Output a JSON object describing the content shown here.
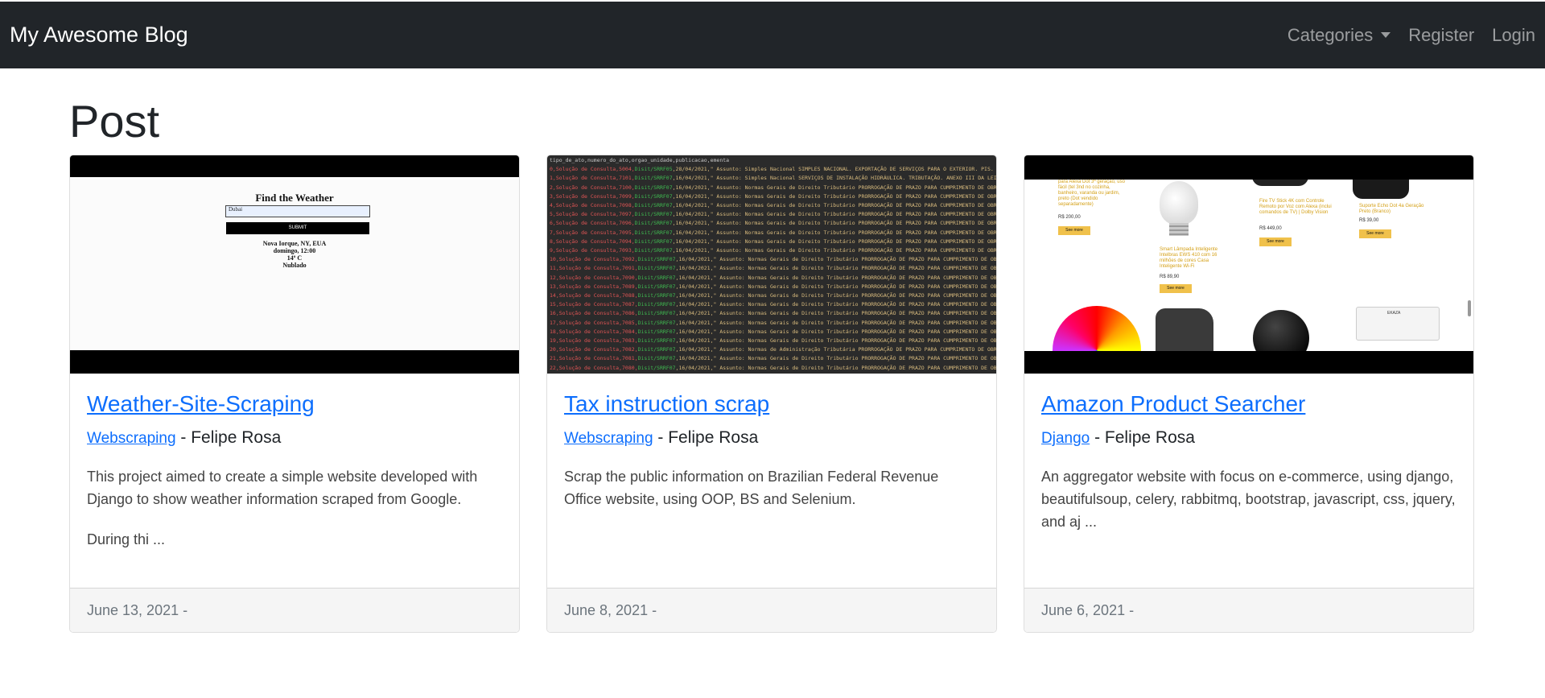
{
  "navbar": {
    "brand": "My Awesome Blog",
    "links": [
      {
        "label": "Categories",
        "dropdown": true
      },
      {
        "label": "Register",
        "dropdown": false
      },
      {
        "label": "Login",
        "dropdown": false
      }
    ]
  },
  "page": {
    "title": "Post"
  },
  "posts": [
    {
      "title": "Weather-Site-Scraping",
      "category": "Webscraping",
      "author": "- Felipe Rosa",
      "excerpt_1": "This project aimed to create a simple website developed with Django to show weather information scraped from Google.",
      "excerpt_2": "During thi ...",
      "date": "June 13, 2021 -",
      "thumb": {
        "title": "Find the Weather",
        "input_value": "Dubai",
        "button": "SUBMIT",
        "lines": [
          "Nova Iorque, NY, EUA",
          "domingo, 12:00",
          "14º C",
          "Nublado"
        ]
      }
    },
    {
      "title": "Tax instruction scrap",
      "category": "Webscraping",
      "author": "- Felipe Rosa",
      "excerpt_1": "Scrap the public information on Brazilian Federal Revenue Office website, using OOP, BS and Selenium.",
      "excerpt_2": "",
      "date": "June 8, 2021 -",
      "thumb": {
        "header": "tipo_de_ato,numero_do_ato,orgao_unidade,publicacao,ementa",
        "rows": [
          [
            "0,Solução de Consulta,5004,",
            "Disit/SRRF05",
            ",28/04/2021,\" Assunto: Simples Nacional SIMPLES NACIONAL. EXPORTAÇÃO DE SERVIÇOS PARA O EXTERIOR. PIS. COFI"
          ],
          [
            "1,Solução de Consulta,7101,",
            "Disit/SRRF07",
            ",16/04/2021,\" Assunto: Simples Nacional SERVIÇOS DE INSTALAÇÃO HIDRÁULICA. TRIBUTAÇÃO. ANEXO III DA LEI COM"
          ],
          [
            "2,Solução de Consulta,7100,",
            "Disit/SRRF07",
            ",16/04/2021,\" Assunto: Normas Gerais de Direito Tributário PRORROGAÇÃO DE PRAZO PARA CUMPRIMENTO DE OBRIGA"
          ],
          [
            "3,Solução de Consulta,7099,",
            "Disit/SRRF07",
            ",16/04/2021,\" Assunto: Normas Gerais de Direito Tributário PRORROGAÇÃO DE PRAZO PARA CUMPRIMENTO DE OBRIGA"
          ],
          [
            "4,Solução de Consulta,7098,",
            "Disit/SRRF07",
            ",16/04/2021,\" Assunto: Normas Gerais de Direito Tributário PRORROGAÇÃO DE PRAZO PARA CUMPRIMENTO DE OBRIGA"
          ],
          [
            "5,Solução de Consulta,7097,",
            "Disit/SRRF07",
            ",16/04/2021,\" Assunto: Normas Gerais de Direito Tributário PRORROGAÇÃO DE PRAZO PARA CUMPRIMENTO DE OBRIGA"
          ],
          [
            "6,Solução de Consulta,7096,",
            "Disit/SRRF07",
            ",16/04/2021,\" Assunto: Normas Gerais de Direito Tributário PRORROGAÇÃO DE PRAZO PARA CUMPRIMENTO DE OBRIGA"
          ],
          [
            "7,Solução de Consulta,7095,",
            "Disit/SRRF07",
            ",16/04/2021,\" Assunto: Normas Gerais de Direito Tributário PRORROGAÇÃO DE PRAZO PARA CUMPRIMENTO DE OBRIGA"
          ],
          [
            "8,Solução de Consulta,7094,",
            "Disit/SRRF07",
            ",16/04/2021,\" Assunto: Normas Gerais de Direito Tributário PRORROGAÇÃO DE PRAZO PARA CUMPRIMENTO DE OBRIGA"
          ],
          [
            "9,Solução de Consulta,7093,",
            "Disit/SRRF07",
            ",16/04/2021,\" Assunto: Normas Gerais de Direito Tributário PRORROGAÇÃO DE PRAZO PARA CUMPRIMENTO DE OBRIGA"
          ],
          [
            "10,Solução de Consulta,7092,",
            "Disit/SRRF07",
            ",16/04/2021,\" Assunto: Normas Gerais de Direito Tributário PRORROGAÇÃO DE PRAZO PARA CUMPRIMENTO DE OBRIGA"
          ],
          [
            "11,Solução de Consulta,7091,",
            "Disit/SRRF07",
            ",16/04/2021,\" Assunto: Normas Gerais de Direito Tributário PRORROGAÇÃO DE PRAZO PARA CUMPRIMENTO DE OBRIGA"
          ],
          [
            "12,Solução de Consulta,7090,",
            "Disit/SRRF07",
            ",16/04/2021,\" Assunto: Normas Gerais de Direito Tributário PRORROGAÇÃO DE PRAZO PARA CUMPRIMENTO DE OBRIGA"
          ],
          [
            "13,Solução de Consulta,7089,",
            "Disit/SRRF07",
            ",16/04/2021,\" Assunto: Normas Gerais de Direito Tributário PRORROGAÇÃO DE PRAZO PARA CUMPRIMENTO DE OBRIGA"
          ],
          [
            "14,Solução de Consulta,7088,",
            "Disit/SRRF07",
            ",16/04/2021,\" Assunto: Normas Gerais de Direito Tributário PRORROGAÇÃO DE PRAZO PARA CUMPRIMENTO DE OBRIGA"
          ],
          [
            "15,Solução de Consulta,7087,",
            "Disit/SRRF07",
            ",16/04/2021,\" Assunto: Normas Gerais de Direito Tributário PRORROGAÇÃO DE PRAZO PARA CUMPRIMENTO DE OBRIGA"
          ],
          [
            "16,Solução de Consulta,7086,",
            "Disit/SRRF07",
            ",16/04/2021,\" Assunto: Normas Gerais de Direito Tributário PRORROGAÇÃO DE PRAZO PARA CUMPRIMENTO DE OBRIGA"
          ],
          [
            "17,Solução de Consulta,7085,",
            "Disit/SRRF07",
            ",16/04/2021,\" Assunto: Normas Gerais de Direito Tributário PRORROGAÇÃO DE PRAZO PARA CUMPRIMENTO DE OBRIGA"
          ],
          [
            "18,Solução de Consulta,7084,",
            "Disit/SRRF07",
            ",16/04/2021,\" Assunto: Normas Gerais de Direito Tributário PRORROGAÇÃO DE PRAZO PARA CUMPRIMENTO DE OBRIGA"
          ],
          [
            "19,Solução de Consulta,7083,",
            "Disit/SRRF07",
            ",16/04/2021,\" Assunto: Normas Gerais de Direito Tributário PRORROGAÇÃO DE PRAZO PARA CUMPRIMENTO DE OBRIGA"
          ],
          [
            "20,Solução de Consulta,7082,",
            "Disit/SRRF07",
            ",16/04/2021,\" Assunto: Normas de Administração Tributária PRORROGAÇÃO DE PRAZO PARA CUMPRIMENTO DE OBRIGA"
          ],
          [
            "21,Solução de Consulta,7081,",
            "Disit/SRRF07",
            ",16/04/2021,\" Assunto: Normas Gerais de Direito Tributário PRORROGAÇÃO DE PRAZO PARA CUMPRIMENTO DE OBRIGA"
          ],
          [
            "22,Solução de Consulta,7080,",
            "Disit/SRRF07",
            ",16/04/2021,\" Assunto: Normas Gerais de Direito Tributário PRORROGAÇÃO DE PRAZO PARA CUMPRIMENTO DE OBRIGA"
          ],
          [
            "23,Solução de Consulta,7079,",
            "Disit/SRRF07",
            ",16/04/2021,\" Assunto: Normas Gerais de Direito Tributário PRORROGAÇÃO DE PRAZO PARA CUMPRIMENTO DE OBRIGA"
          ]
        ]
      }
    },
    {
      "title": "Amazon Product Searcher",
      "category": "Django",
      "author": "- Felipe Rosa",
      "excerpt_1": "An aggregator website with focus on e-commerce, using django, beautifulsoup, celery, rabbitmq, bootstrap, javascript, css, jquery, and aj ...",
      "excerpt_2": "",
      "date": "June 6, 2021 -",
      "thumb": {
        "p1_text": "para Alexa Dot 3ª geração, uso fácil (tel 3nd no cozinha, banheiro, varanda ou jardim, preto (Dot vendido separadamente)",
        "p1_price": "R$ 200,00",
        "p2_text": "Smart Lâmpada Inteligente Intelbras EWS 410 com 16 milhões de cores Casa Inteligente Wi-Fi",
        "p2_price": "R$ 89,90",
        "p3_text": "Fire TV Stick 4K com Controle Remoto por Voz com Alexa (inclui comandos de TV) | Dolby Vision",
        "p3_price": "R$ 449,00",
        "p4_text": "Suporte Echo Dot 4a Geração Preto (Branco)",
        "p4_price": "R$ 39,00",
        "see_more": "See more",
        "switch_label": "EKAZA"
      }
    }
  ],
  "colors": {
    "navbar_bg": "#212529",
    "link": "#0d6efd",
    "footer_bg": "#f5f5f5"
  }
}
